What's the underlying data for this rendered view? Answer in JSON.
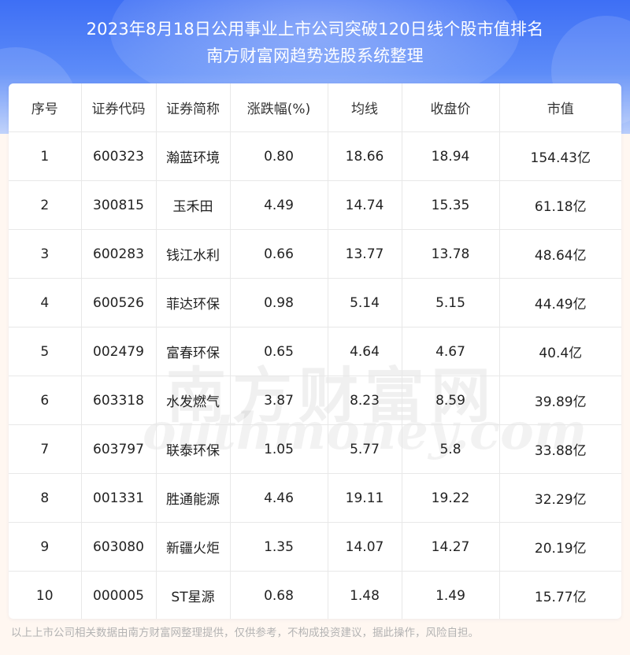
{
  "header": {
    "title_line1": "2023年8月18日公用事业上市公司突破120日线个股市值排名",
    "title_line2": "南方财富网趋势选股系统整理"
  },
  "table": {
    "columns": [
      "序号",
      "证券代码",
      "证券简称",
      "涨跌幅(%)",
      "均线",
      "收盘价",
      "市值"
    ],
    "rows": [
      [
        "1",
        "600323",
        "瀚蓝环境",
        "0.80",
        "18.66",
        "18.94",
        "154.43亿"
      ],
      [
        "2",
        "300815",
        "玉禾田",
        "4.49",
        "14.74",
        "15.35",
        "61.18亿"
      ],
      [
        "3",
        "600283",
        "钱江水利",
        "0.66",
        "13.77",
        "13.78",
        "48.64亿"
      ],
      [
        "4",
        "600526",
        "菲达环保",
        "0.98",
        "5.14",
        "5.15",
        "44.49亿"
      ],
      [
        "5",
        "002479",
        "富春环保",
        "0.65",
        "4.64",
        "4.67",
        "40.4亿"
      ],
      [
        "6",
        "603318",
        "水发燃气",
        "3.87",
        "8.23",
        "8.59",
        "39.89亿"
      ],
      [
        "7",
        "603797",
        "联泰环保",
        "1.05",
        "5.77",
        "5.8",
        "33.88亿"
      ],
      [
        "8",
        "001331",
        "胜通能源",
        "4.46",
        "19.11",
        "19.22",
        "32.29亿"
      ],
      [
        "9",
        "603080",
        "新疆火炬",
        "1.35",
        "14.07",
        "14.27",
        "20.19亿"
      ],
      [
        "10",
        "000005",
        "ST星源",
        "0.68",
        "1.48",
        "1.49",
        "15.77亿"
      ]
    ]
  },
  "watermark": {
    "cn": "南方财富网",
    "en": "outhmoney.com"
  },
  "footer": {
    "disclaimer": "以上上市公司相关数据由南方财富网整理提供，仅供参考，不构成投资建议，据此操作，风险自担。"
  },
  "colors": {
    "header_top": "#3e6ff5",
    "header_bottom": "#b9cdfb",
    "background": "#fff7f1",
    "text": "#222222",
    "footer_text": "#b3b3b3"
  }
}
